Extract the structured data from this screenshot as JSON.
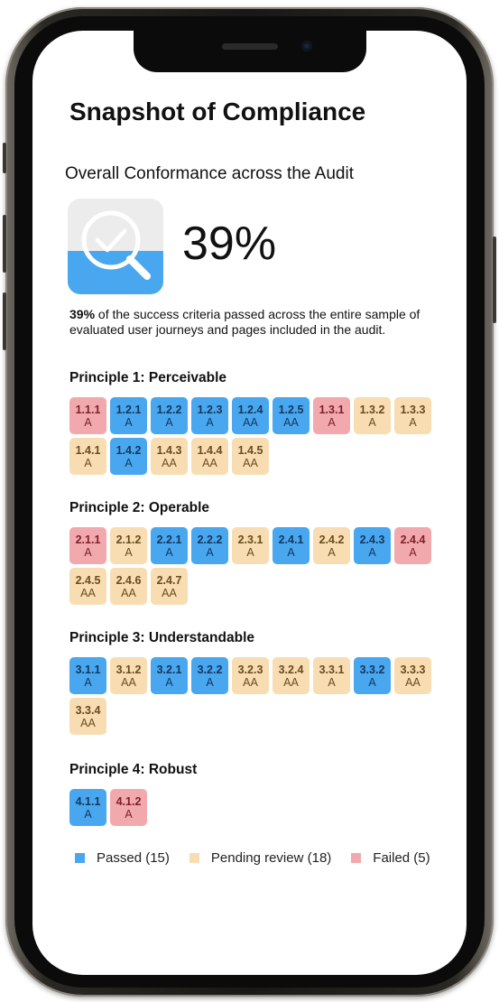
{
  "page": {
    "title": "Snapshot of Compliance",
    "subtitle": "Overall Conformance across the Audit",
    "percent": "39%",
    "desc_bold": "39%",
    "desc_rest": " of the success criteria passed across the entire sample of evaluated user journeys and pages included in the audit."
  },
  "colors": {
    "passed": "#49a7ef",
    "pending": "#f8ddb3",
    "failed": "#f2a9ad"
  },
  "principles": [
    {
      "label": "Principle 1: Perceivable",
      "criteria": [
        {
          "num": "1.1.1",
          "level": "A",
          "status": "failed"
        },
        {
          "num": "1.2.1",
          "level": "A",
          "status": "passed"
        },
        {
          "num": "1.2.2",
          "level": "A",
          "status": "passed"
        },
        {
          "num": "1.2.3",
          "level": "A",
          "status": "passed"
        },
        {
          "num": "1.2.4",
          "level": "AA",
          "status": "passed"
        },
        {
          "num": "1.2.5",
          "level": "AA",
          "status": "passed"
        },
        {
          "num": "1.3.1",
          "level": "A",
          "status": "failed"
        },
        {
          "num": "1.3.2",
          "level": "A",
          "status": "pending"
        },
        {
          "num": "1.3.3",
          "level": "A",
          "status": "pending"
        },
        {
          "num": "1.4.1",
          "level": "A",
          "status": "pending"
        },
        {
          "num": "1.4.2",
          "level": "A",
          "status": "passed"
        },
        {
          "num": "1.4.3",
          "level": "AA",
          "status": "pending"
        },
        {
          "num": "1.4.4",
          "level": "AA",
          "status": "pending"
        },
        {
          "num": "1.4.5",
          "level": "AA",
          "status": "pending"
        }
      ]
    },
    {
      "label": "Principle 2: Operable",
      "criteria": [
        {
          "num": "2.1.1",
          "level": "A",
          "status": "failed"
        },
        {
          "num": "2.1.2",
          "level": "A",
          "status": "pending"
        },
        {
          "num": "2.2.1",
          "level": "A",
          "status": "passed"
        },
        {
          "num": "2.2.2",
          "level": "A",
          "status": "passed"
        },
        {
          "num": "2.3.1",
          "level": "A",
          "status": "pending"
        },
        {
          "num": "2.4.1",
          "level": "A",
          "status": "passed"
        },
        {
          "num": "2.4.2",
          "level": "A",
          "status": "pending"
        },
        {
          "num": "2.4.3",
          "level": "A",
          "status": "passed"
        },
        {
          "num": "2.4.4",
          "level": "A",
          "status": "failed"
        },
        {
          "num": "2.4.5",
          "level": "AA",
          "status": "pending"
        },
        {
          "num": "2.4.6",
          "level": "AA",
          "status": "pending"
        },
        {
          "num": "2.4.7",
          "level": "AA",
          "status": "pending"
        }
      ]
    },
    {
      "label": "Principle 3: Understandable",
      "criteria": [
        {
          "num": "3.1.1",
          "level": "A",
          "status": "passed"
        },
        {
          "num": "3.1.2",
          "level": "AA",
          "status": "pending"
        },
        {
          "num": "3.2.1",
          "level": "A",
          "status": "passed"
        },
        {
          "num": "3.2.2",
          "level": "A",
          "status": "passed"
        },
        {
          "num": "3.2.3",
          "level": "AA",
          "status": "pending"
        },
        {
          "num": "3.2.4",
          "level": "AA",
          "status": "pending"
        },
        {
          "num": "3.3.1",
          "level": "A",
          "status": "pending"
        },
        {
          "num": "3.3.2",
          "level": "A",
          "status": "passed"
        },
        {
          "num": "3.3.3",
          "level": "AA",
          "status": "pending"
        },
        {
          "num": "3.3.4",
          "level": "AA",
          "status": "pending"
        }
      ]
    },
    {
      "label": "Principle 4: Robust",
      "criteria": [
        {
          "num": "4.1.1",
          "level": "A",
          "status": "passed"
        },
        {
          "num": "4.1.2",
          "level": "A",
          "status": "failed"
        }
      ]
    }
  ],
  "legend": [
    {
      "label": "Passed (15)",
      "status": "passed"
    },
    {
      "label": "Pending review (18)",
      "status": "pending"
    },
    {
      "label": "Failed (5)",
      "status": "failed"
    }
  ]
}
